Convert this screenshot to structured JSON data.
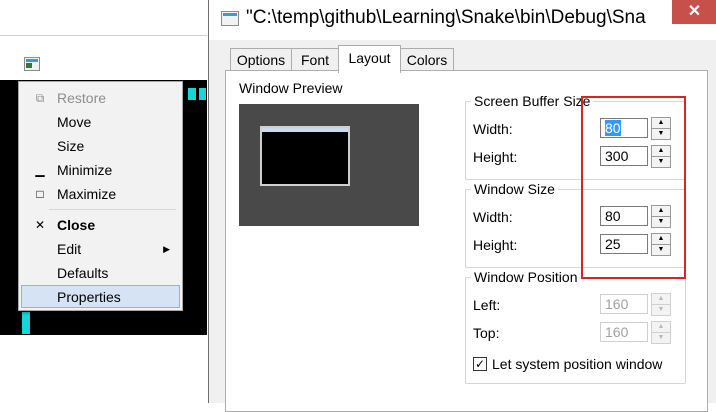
{
  "context_menu": {
    "items": [
      {
        "label": "Restore",
        "icon": "restore-icon",
        "glyph": "⧉",
        "state": "disabled"
      },
      {
        "label": "Move",
        "icon": "",
        "glyph": "",
        "state": "normal"
      },
      {
        "label": "Size",
        "icon": "",
        "glyph": "",
        "state": "normal"
      },
      {
        "label": "Minimize",
        "icon": "minimize-icon",
        "glyph": "▁",
        "state": "normal"
      },
      {
        "label": "Maximize",
        "icon": "maximize-icon",
        "glyph": "□",
        "state": "normal"
      },
      {
        "label": "Close",
        "icon": "close-icon",
        "glyph": "✕",
        "state": "bold"
      },
      {
        "label": "Edit",
        "icon": "submenu-arrow-icon",
        "glyph": "▶",
        "state": "submenu"
      },
      {
        "label": "Defaults",
        "icon": "",
        "glyph": "",
        "state": "normal"
      },
      {
        "label": "Properties",
        "icon": "",
        "glyph": "",
        "state": "selected"
      }
    ]
  },
  "dialog": {
    "title": "\"C:\\temp\\github\\Learning\\Snake\\bin\\Debug\\Sna",
    "close_glyph": "✕",
    "tabs": [
      "Options",
      "Font",
      "Layout",
      "Colors"
    ],
    "active_tab": "Layout",
    "preview_label": "Window Preview",
    "screen_buffer": {
      "title": "Screen Buffer Size",
      "width_label": "Width:",
      "width_value": "80",
      "height_label": "Height:",
      "height_value": "300"
    },
    "window_size": {
      "title": "Window Size",
      "width_label": "Width:",
      "width_value": "80",
      "height_label": "Height:",
      "height_value": "25"
    },
    "window_position": {
      "title": "Window Position",
      "left_label": "Left:",
      "left_value": "160",
      "top_label": "Top:",
      "top_value": "160",
      "checkbox_label": "Let system position window",
      "checkbox_checked": true
    },
    "accent_color": "#d8232a"
  }
}
